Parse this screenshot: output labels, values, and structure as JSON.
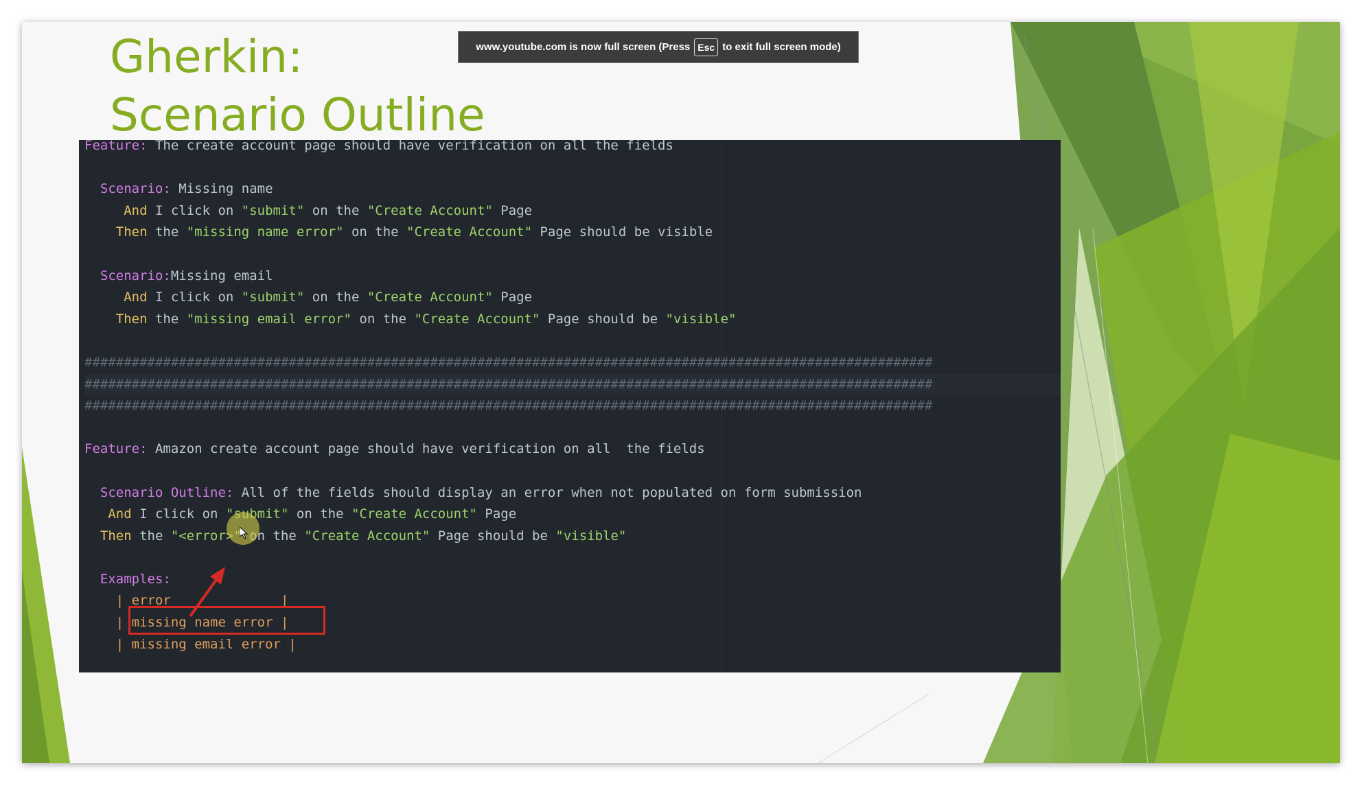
{
  "slide": {
    "title_line1": "Gherkin:",
    "title_line2": "Scenario Outline",
    "accent_color": "#86ad22"
  },
  "fullscreen_banner": {
    "text_before": "www.youtube.com is now full screen (Press",
    "key": "Esc",
    "text_after": "to exit full screen mode)"
  },
  "code": {
    "lines": [
      {
        "tokens": [
          {
            "t": "Feature:",
            "c": "kw"
          },
          {
            "t": " The create account page should have verification on all the fields",
            "c": ""
          }
        ]
      },
      {
        "tokens": []
      },
      {
        "tokens": [
          {
            "t": "  Scenario:",
            "c": "kw"
          },
          {
            "t": " Missing name",
            "c": ""
          }
        ]
      },
      {
        "tokens": [
          {
            "t": "     And",
            "c": "kwy"
          },
          {
            "t": " I click on ",
            "c": ""
          },
          {
            "t": "\"submit\"",
            "c": "str"
          },
          {
            "t": " on the ",
            "c": ""
          },
          {
            "t": "\"Create Account\"",
            "c": "str"
          },
          {
            "t": " Page",
            "c": ""
          }
        ]
      },
      {
        "tokens": [
          {
            "t": "    Then",
            "c": "kwy"
          },
          {
            "t": " the ",
            "c": ""
          },
          {
            "t": "\"missing name error\"",
            "c": "str"
          },
          {
            "t": " on the ",
            "c": ""
          },
          {
            "t": "\"Create Account\"",
            "c": "str"
          },
          {
            "t": " Page should be visible",
            "c": ""
          }
        ]
      },
      {
        "tokens": []
      },
      {
        "tokens": [
          {
            "t": "  Scenario:",
            "c": "kw"
          },
          {
            "t": "Missing email",
            "c": ""
          }
        ]
      },
      {
        "tokens": [
          {
            "t": "     And",
            "c": "kwy"
          },
          {
            "t": " I click on ",
            "c": ""
          },
          {
            "t": "\"submit\"",
            "c": "str"
          },
          {
            "t": " on the ",
            "c": ""
          },
          {
            "t": "\"Create Account\"",
            "c": "str"
          },
          {
            "t": " Page",
            "c": ""
          }
        ]
      },
      {
        "tokens": [
          {
            "t": "    Then",
            "c": "kwy"
          },
          {
            "t": " the ",
            "c": ""
          },
          {
            "t": "\"missing email error\"",
            "c": "str"
          },
          {
            "t": " on the ",
            "c": ""
          },
          {
            "t": "\"Create Account\"",
            "c": "str"
          },
          {
            "t": " Page should be ",
            "c": ""
          },
          {
            "t": "\"visible\"",
            "c": "str"
          }
        ]
      },
      {
        "tokens": []
      },
      {
        "tokens": [
          {
            "t": "############################################################################################################",
            "c": "cmt"
          }
        ]
      },
      {
        "tokens": [
          {
            "t": "############################################################################################################",
            "c": "cmt"
          }
        ],
        "highlight": true
      },
      {
        "tokens": [
          {
            "t": "############################################################################################################",
            "c": "cmt"
          }
        ]
      },
      {
        "tokens": []
      },
      {
        "tokens": [
          {
            "t": "Feature:",
            "c": "kw"
          },
          {
            "t": " Amazon create account page should have verification on all  the fields",
            "c": ""
          }
        ]
      },
      {
        "tokens": []
      },
      {
        "tokens": [
          {
            "t": "  Scenario Outline:",
            "c": "kw"
          },
          {
            "t": " All of the fields should display an error when not populated on form submission",
            "c": ""
          }
        ]
      },
      {
        "tokens": [
          {
            "t": "   And",
            "c": "kwy"
          },
          {
            "t": " I click on ",
            "c": ""
          },
          {
            "t": "\"submit\"",
            "c": "str"
          },
          {
            "t": " on the ",
            "c": ""
          },
          {
            "t": "\"Create Account\"",
            "c": "str"
          },
          {
            "t": " Page",
            "c": ""
          }
        ]
      },
      {
        "tokens": [
          {
            "t": "  Then",
            "c": "kwy"
          },
          {
            "t": " the ",
            "c": ""
          },
          {
            "t": "\"<error>\"",
            "c": "str"
          },
          {
            "t": " on the ",
            "c": ""
          },
          {
            "t": "\"Create Account\"",
            "c": "str"
          },
          {
            "t": " Page should be ",
            "c": ""
          },
          {
            "t": "\"visible\"",
            "c": "str"
          }
        ]
      },
      {
        "tokens": []
      },
      {
        "tokens": [
          {
            "t": "  Examples:",
            "c": "kw"
          }
        ]
      },
      {
        "tokens": [
          {
            "t": "    | error              |",
            "c": "tbl"
          }
        ]
      },
      {
        "tokens": [
          {
            "t": "    | missing name error |",
            "c": "tbl"
          }
        ]
      },
      {
        "tokens": [
          {
            "t": "    | missing email error |",
            "c": "tbl"
          }
        ]
      }
    ]
  },
  "annotation_color": "#d52b24"
}
